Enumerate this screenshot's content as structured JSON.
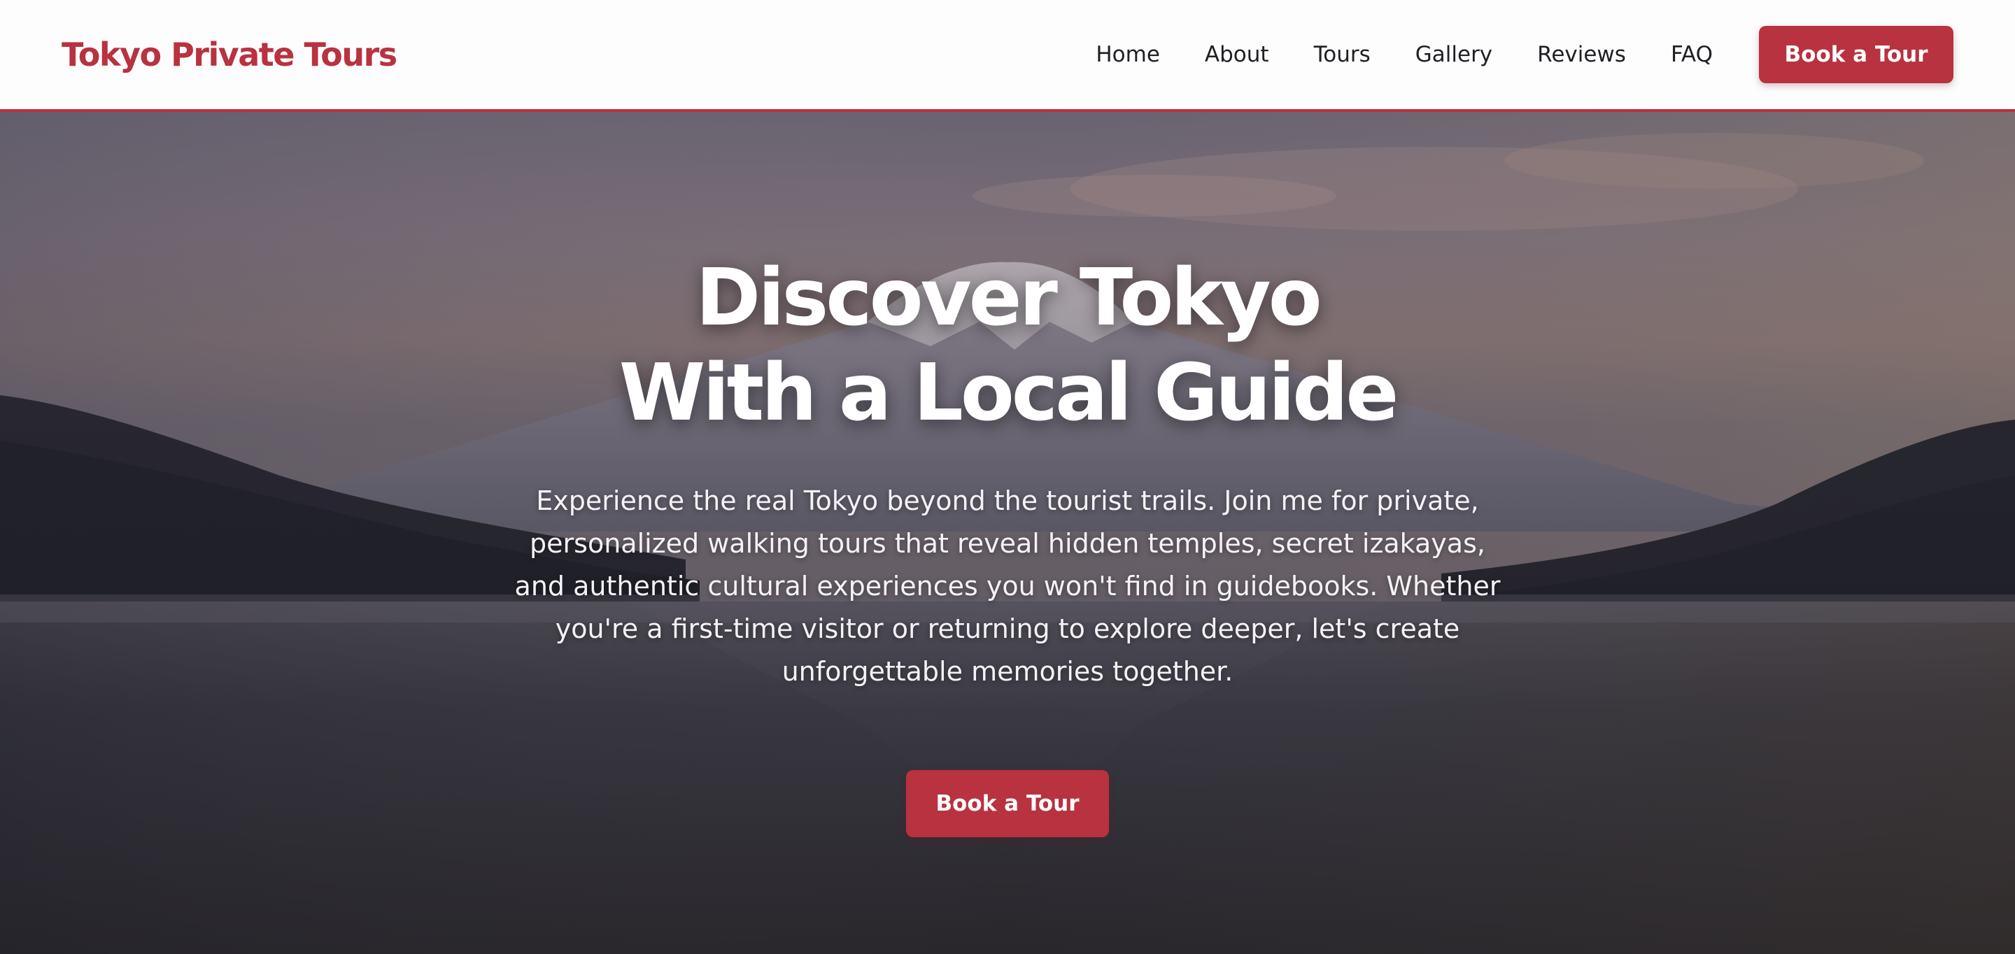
{
  "header": {
    "brand": "Tokyo Private Tours",
    "nav": [
      "Home",
      "About",
      "Tours",
      "Gallery",
      "Reviews",
      "FAQ"
    ],
    "cta_label": "Book a Tour"
  },
  "hero": {
    "title_line1": "Discover Tokyo",
    "title_line2": "With a Local Guide",
    "description": "Experience the real Tokyo beyond the tourist trails. Join me for private, personalized walking tours that reveal hidden temples, secret izakayas, and authentic cultural experiences you won't find in guidebooks. Whether you're a first-time visitor or returning to explore deeper, let's create unforgettable memories together.",
    "cta_label": "Book a Tour",
    "background_image": "mountain-lake-dusk"
  },
  "colors": {
    "accent": "#b8323f",
    "header_bg": "#fdfdfd",
    "nav_text": "#1f1f24",
    "hero_text": "#ffffff"
  }
}
